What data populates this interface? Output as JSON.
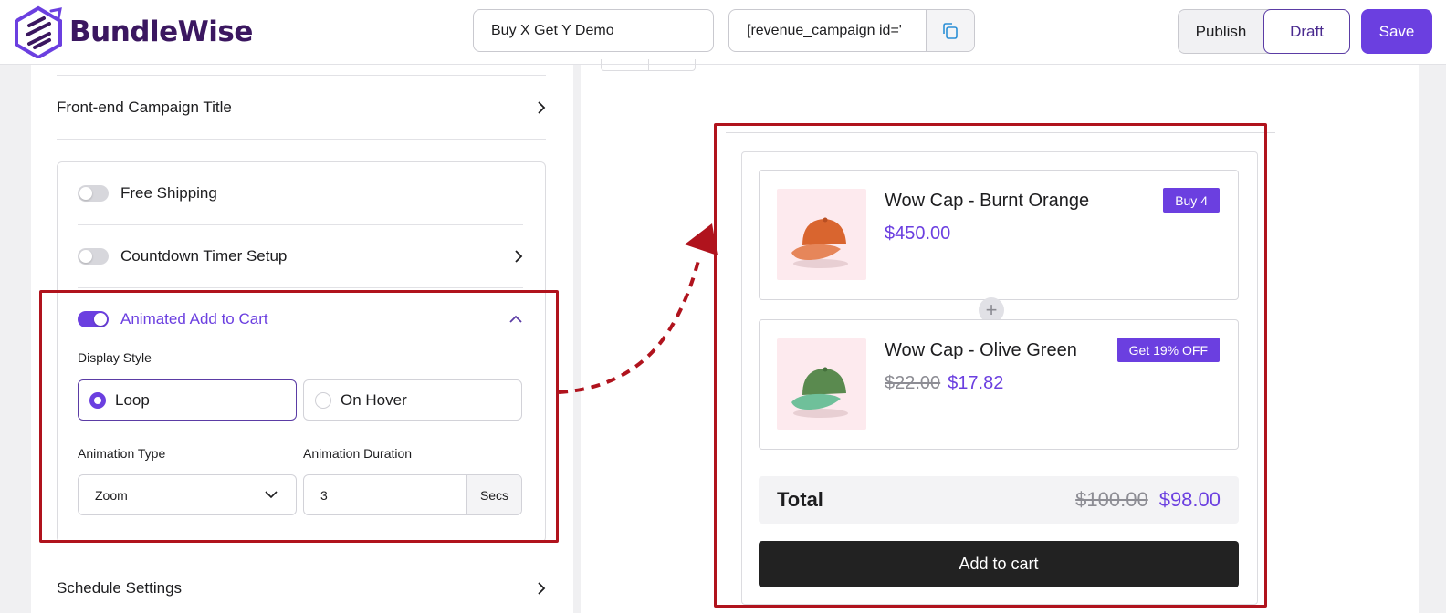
{
  "header": {
    "logo_text": "BundleWise",
    "campaign_title": "Buy X Get Y Demo",
    "shortcode": "[revenue_campaign id='",
    "status": {
      "publish_label": "Publish",
      "draft_label": "Draft",
      "selected": "Draft"
    },
    "save_label": "Save",
    "brand_color": "#6b3fe0"
  },
  "settings": {
    "frontend_title_label": "Front-end Campaign Title",
    "free_shipping": {
      "label": "Free Shipping",
      "enabled": false
    },
    "countdown": {
      "label": "Countdown Timer Setup",
      "enabled": false
    },
    "animated_cart": {
      "label": "Animated Add to Cart",
      "enabled": true,
      "display_style_label": "Display Style",
      "options": [
        "Loop",
        "On Hover"
      ],
      "selected_option": "Loop",
      "animation_type_label": "Animation Type",
      "animation_type_value": "Zoom",
      "animation_duration_label": "Animation Duration",
      "animation_duration_value": "3",
      "animation_duration_unit": "Secs"
    },
    "schedule_label": "Schedule Settings"
  },
  "preview": {
    "products": [
      {
        "name": "Wow Cap - Burnt Orange",
        "price": "$450.00",
        "old_price": "",
        "badge": "Buy 4",
        "color": "#d9652f"
      },
      {
        "name": "Wow Cap - Olive Green",
        "price": "$17.82",
        "old_price": "$22.00",
        "badge": "Get 19% OFF",
        "color": "#5a8a4f"
      }
    ],
    "total_label": "Total",
    "total_old": "$100.00",
    "total_new": "$98.00",
    "add_to_cart_label": "Add to cart"
  }
}
